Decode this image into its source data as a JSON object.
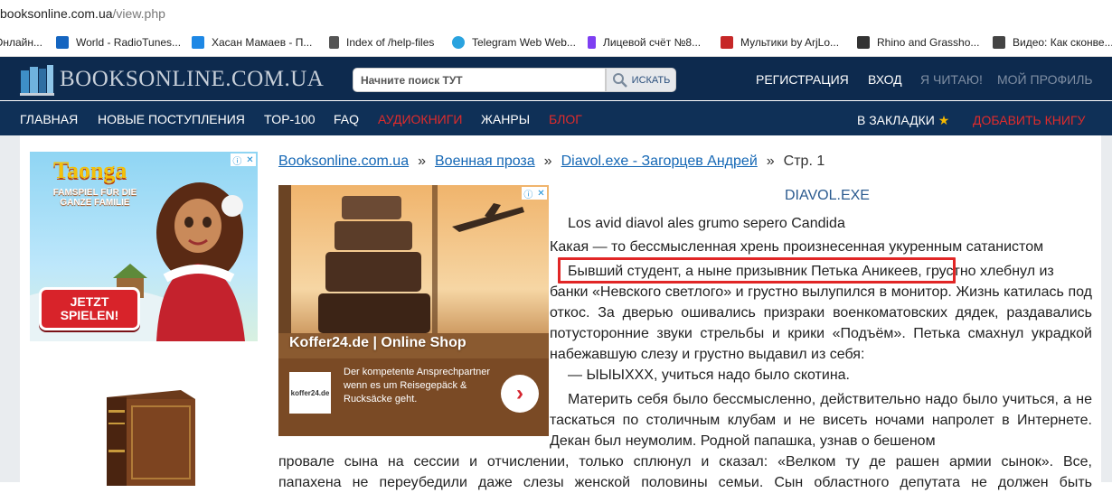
{
  "browser": {
    "url_host": "booksonline.com.ua",
    "url_path": "/view.php",
    "bookmarks": [
      {
        "label": "Онлайн...",
        "icon": "folder-icon",
        "color": "#888888"
      },
      {
        "label": "World - RadioTunes...",
        "icon": "radiotunes-icon",
        "color": "#1565c0"
      },
      {
        "label": "Хасан Мамаев - П...",
        "icon": "smile-icon",
        "color": "#1e88e5"
      },
      {
        "label": "Index of /help-files",
        "icon": "file-icon",
        "color": "#555555"
      },
      {
        "label": "Telegram Web Web...",
        "icon": "telegram-icon",
        "color": "#2aa3df"
      },
      {
        "label": "Лицевой счёт №8...",
        "icon": "bookmark-icon",
        "color": "#7e3ff2"
      },
      {
        "label": "Мультики by ArjLo...",
        "icon": "arj-icon",
        "color": "#c62828"
      },
      {
        "label": "Rhino and Grassho...",
        "icon": "rhino-icon",
        "color": "#333333"
      },
      {
        "label": "Видео: Как сконве...",
        "icon": "video-icon",
        "color": "#444444"
      }
    ]
  },
  "site": {
    "logo_text": "BOOKSONLINE.COM.UA",
    "search_placeholder": "Начните поиск ТУТ",
    "search_button": "ИСКАТЬ",
    "top_links": {
      "register": "РЕГИСТРАЦИЯ",
      "login": "ВХОД",
      "reading": "Я ЧИТАЮ!",
      "profile": "МОЙ ПРОФИЛЬ"
    },
    "nav": {
      "home": "ГЛАВНАЯ",
      "new": "НОВЫЕ ПОСТУПЛЕНИЯ",
      "top": "TOP-100",
      "faq": "FAQ",
      "audio": "АУДИОКНИГИ",
      "genres": "ЖАНРЫ",
      "blog": "БЛОГ",
      "bookmarks": "В ЗАКЛАДКИ",
      "add_book": "ДОБАВИТЬ КНИГУ"
    },
    "accent_red": "#e02b2b",
    "header_color": "#0d2a4e"
  },
  "breadcrumb": {
    "home": "Booksonline.com.ua",
    "category": "Военная проза",
    "book": "Diavol.exe - Загорцев Андрей",
    "page": "Стр. 1",
    "separator": "»"
  },
  "ads": {
    "left": {
      "title": "Taonga",
      "subtitle": "FAMSPIEL FÜR DIE GANZE FAMILIE",
      "button": "JETZT SPIELEN!"
    },
    "mid": {
      "name": "Koffer24.de | Online Shop",
      "logo": "koffer24.de",
      "description": "Der kompetente Ansprechpartner wenn es um Reisegepäck & Rucksäcke geht.",
      "arrow": "›"
    }
  },
  "book": {
    "title": "DIAVOL.EXE",
    "epigraph": "Los avid diavol ales grumo sepero Candida",
    "line1": "Какая — то бессмысленная хрень произнесенная укуренным сатанистом",
    "highlighted": "Бывший студент, а ныне призывник Петька Аникеев,",
    "line2_rest": "грустно хлебнул из",
    "para2": "банки «Невского светлого» и грустно вылупился в монитор. Жизнь катилась под откос. За дверью ошивались призраки военкоматовских дядек, раздавались потусторонние звуки стрельбы и крики «Подъём». Петька смахнул украдкой набежавшую слезу и грустно выдавил из себя:",
    "quote": "— ЫЫЫХХХ, учиться надо было скотина.",
    "para3": "Материть себя было бессмысленно, действительно надо было учиться, а не таскаться по столичным клубам и не висеть ночами напролет в Интернете. Декан был неумолим. Родной папашка, узнав о бешеном",
    "para4a": "провале сына на сессии и отчислении, только сплюнул и сказал: «Велком ту де рашен армии сынок». Все,",
    "para4b": "папахена не переубедили даже слезы женской половины семьи. Сын областного депутата не должен быть"
  }
}
